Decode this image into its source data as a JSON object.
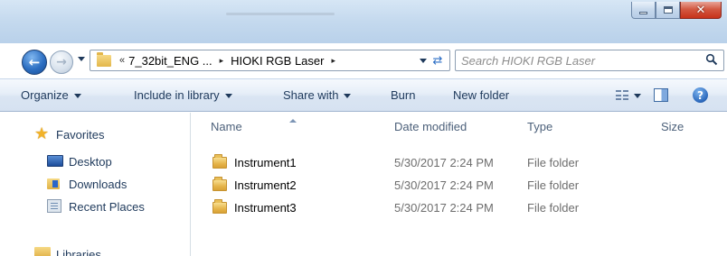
{
  "window": {
    "controls": {
      "minimize": "minimize",
      "maximize": "maximize",
      "close": "✕"
    }
  },
  "nav": {
    "back_icon": "back-arrow-icon",
    "forward_icon": "forward-arrow-icon"
  },
  "address": {
    "overflow": "«",
    "crumbs": [
      "7_32bit_ENG ...",
      "HIOKI RGB Laser"
    ],
    "separator": "▸"
  },
  "search": {
    "placeholder": "Search HIOKI RGB Laser"
  },
  "toolbar": {
    "organize": "Organize",
    "include_in_library": "Include in library",
    "share_with": "Share with",
    "burn": "Burn",
    "new_folder": "New folder"
  },
  "sidebar": {
    "favorites": "Favorites",
    "items": [
      {
        "label": "Desktop",
        "icon": "desktop-icon"
      },
      {
        "label": "Downloads",
        "icon": "downloads-icon"
      },
      {
        "label": "Recent Places",
        "icon": "recent-places-icon"
      }
    ],
    "libraries": "Libraries"
  },
  "columns": {
    "name": "Name",
    "date_modified": "Date modified",
    "type": "Type",
    "size": "Size"
  },
  "files": [
    {
      "name": "Instrument1",
      "date": "5/30/2017 2:24 PM",
      "type": "File folder"
    },
    {
      "name": "Instrument2",
      "date": "5/30/2017 2:24 PM",
      "type": "File folder"
    },
    {
      "name": "Instrument3",
      "date": "5/30/2017 2:24 PM",
      "type": "File folder"
    }
  ],
  "colors": {
    "close_red": "#c7321a",
    "link_blue": "#1e395b",
    "folder_yellow": "#e5b44a"
  }
}
